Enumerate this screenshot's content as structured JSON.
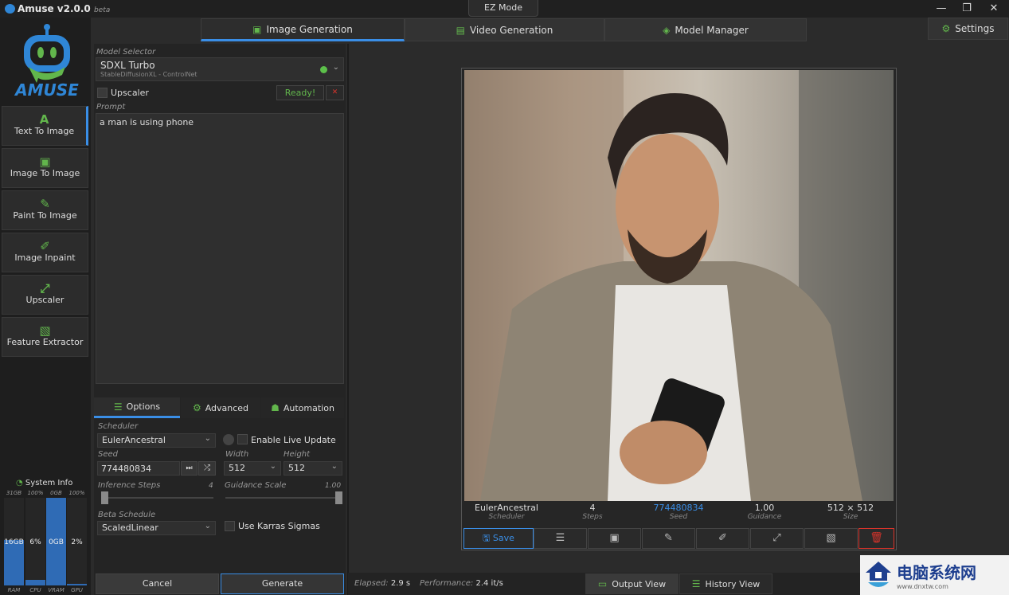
{
  "app": {
    "title": "Amuse v2.0.0",
    "badge": "beta",
    "ez_mode": "EZ Mode",
    "logo_text": "AMUSE"
  },
  "window": {
    "minimize": "—",
    "restore": "❐",
    "close": "✕"
  },
  "top_tabs": [
    {
      "label": "Image Generation",
      "icon": "image-icon",
      "active": true
    },
    {
      "label": "Video Generation",
      "icon": "film-icon"
    },
    {
      "label": "Model Manager",
      "icon": "layers-icon"
    }
  ],
  "settings": {
    "label": "Settings",
    "icon": "gear-icon"
  },
  "sidebar": {
    "items": [
      {
        "label": "Text To Image",
        "icon": "A",
        "active": true
      },
      {
        "label": "Image To Image",
        "icon": "▣"
      },
      {
        "label": "Paint To Image",
        "icon": "✎"
      },
      {
        "label": "Image Inpaint",
        "icon": "✐"
      },
      {
        "label": "Upscaler",
        "icon": "⤢"
      },
      {
        "label": "Feature Extractor",
        "icon": "▧"
      }
    ]
  },
  "system_info": {
    "title": "System Info",
    "meters": [
      {
        "name": "RAM",
        "max": "31GB",
        "value": "16GB",
        "fill": 0.52
      },
      {
        "name": "CPU",
        "max": "100%",
        "value": "6%",
        "fill": 0.06
      },
      {
        "name": "VRAM",
        "max": "0GB",
        "value": "0GB",
        "fill": 1.0
      },
      {
        "name": "GPU",
        "max": "100%",
        "value": "2%",
        "fill": 0.02
      }
    ]
  },
  "model_selector": {
    "label": "Model Selector",
    "name": "SDXL Turbo",
    "sub": "StableDiffusionXL - ControlNet",
    "status_color": "#5cc04a"
  },
  "upscaler": {
    "label": "Upscaler",
    "checked": false,
    "status": "Ready!",
    "clear": "✕"
  },
  "prompt": {
    "label": "Prompt",
    "value": "a man is using phone"
  },
  "option_tabs": [
    {
      "label": "Options",
      "active": true
    },
    {
      "label": "Advanced"
    },
    {
      "label": "Automation"
    }
  ],
  "options": {
    "scheduler_label": "Scheduler",
    "scheduler": "EulerAncestral",
    "live_update": "Enable Live Update",
    "seed_label": "Seed",
    "seed": "774480834",
    "width_label": "Width",
    "width": "512",
    "height_label": "Height",
    "height": "512",
    "steps_label": "Inference Steps",
    "steps": "4",
    "guidance_label": "Guidance Scale",
    "guidance": "1.00",
    "beta_label": "Beta Schedule",
    "beta": "ScaledLinear",
    "karras": "Use Karras Sigmas"
  },
  "actions": {
    "cancel": "Cancel",
    "generate": "Generate"
  },
  "result": {
    "meta": [
      {
        "value": "EulerAncestral",
        "key": "Scheduler"
      },
      {
        "value": "4",
        "key": "Steps"
      },
      {
        "value": "774480834",
        "key": "Seed",
        "link": true
      },
      {
        "value": "1.00",
        "key": "Guidance"
      },
      {
        "value": "512 × 512",
        "key": "Size"
      }
    ],
    "save": "Save"
  },
  "status": {
    "elapsed_label": "Elapsed:",
    "elapsed": "2.9 s",
    "perf_label": "Performance:",
    "perf": "2.4 it/s"
  },
  "views": {
    "output": "Output View",
    "history": "History View"
  },
  "watermark": {
    "text": "电脑系统网",
    "url": "www.dnxtw.com"
  },
  "colors": {
    "accent": "#3a8ee6",
    "green": "#62b64c",
    "danger": "#d9342b"
  }
}
